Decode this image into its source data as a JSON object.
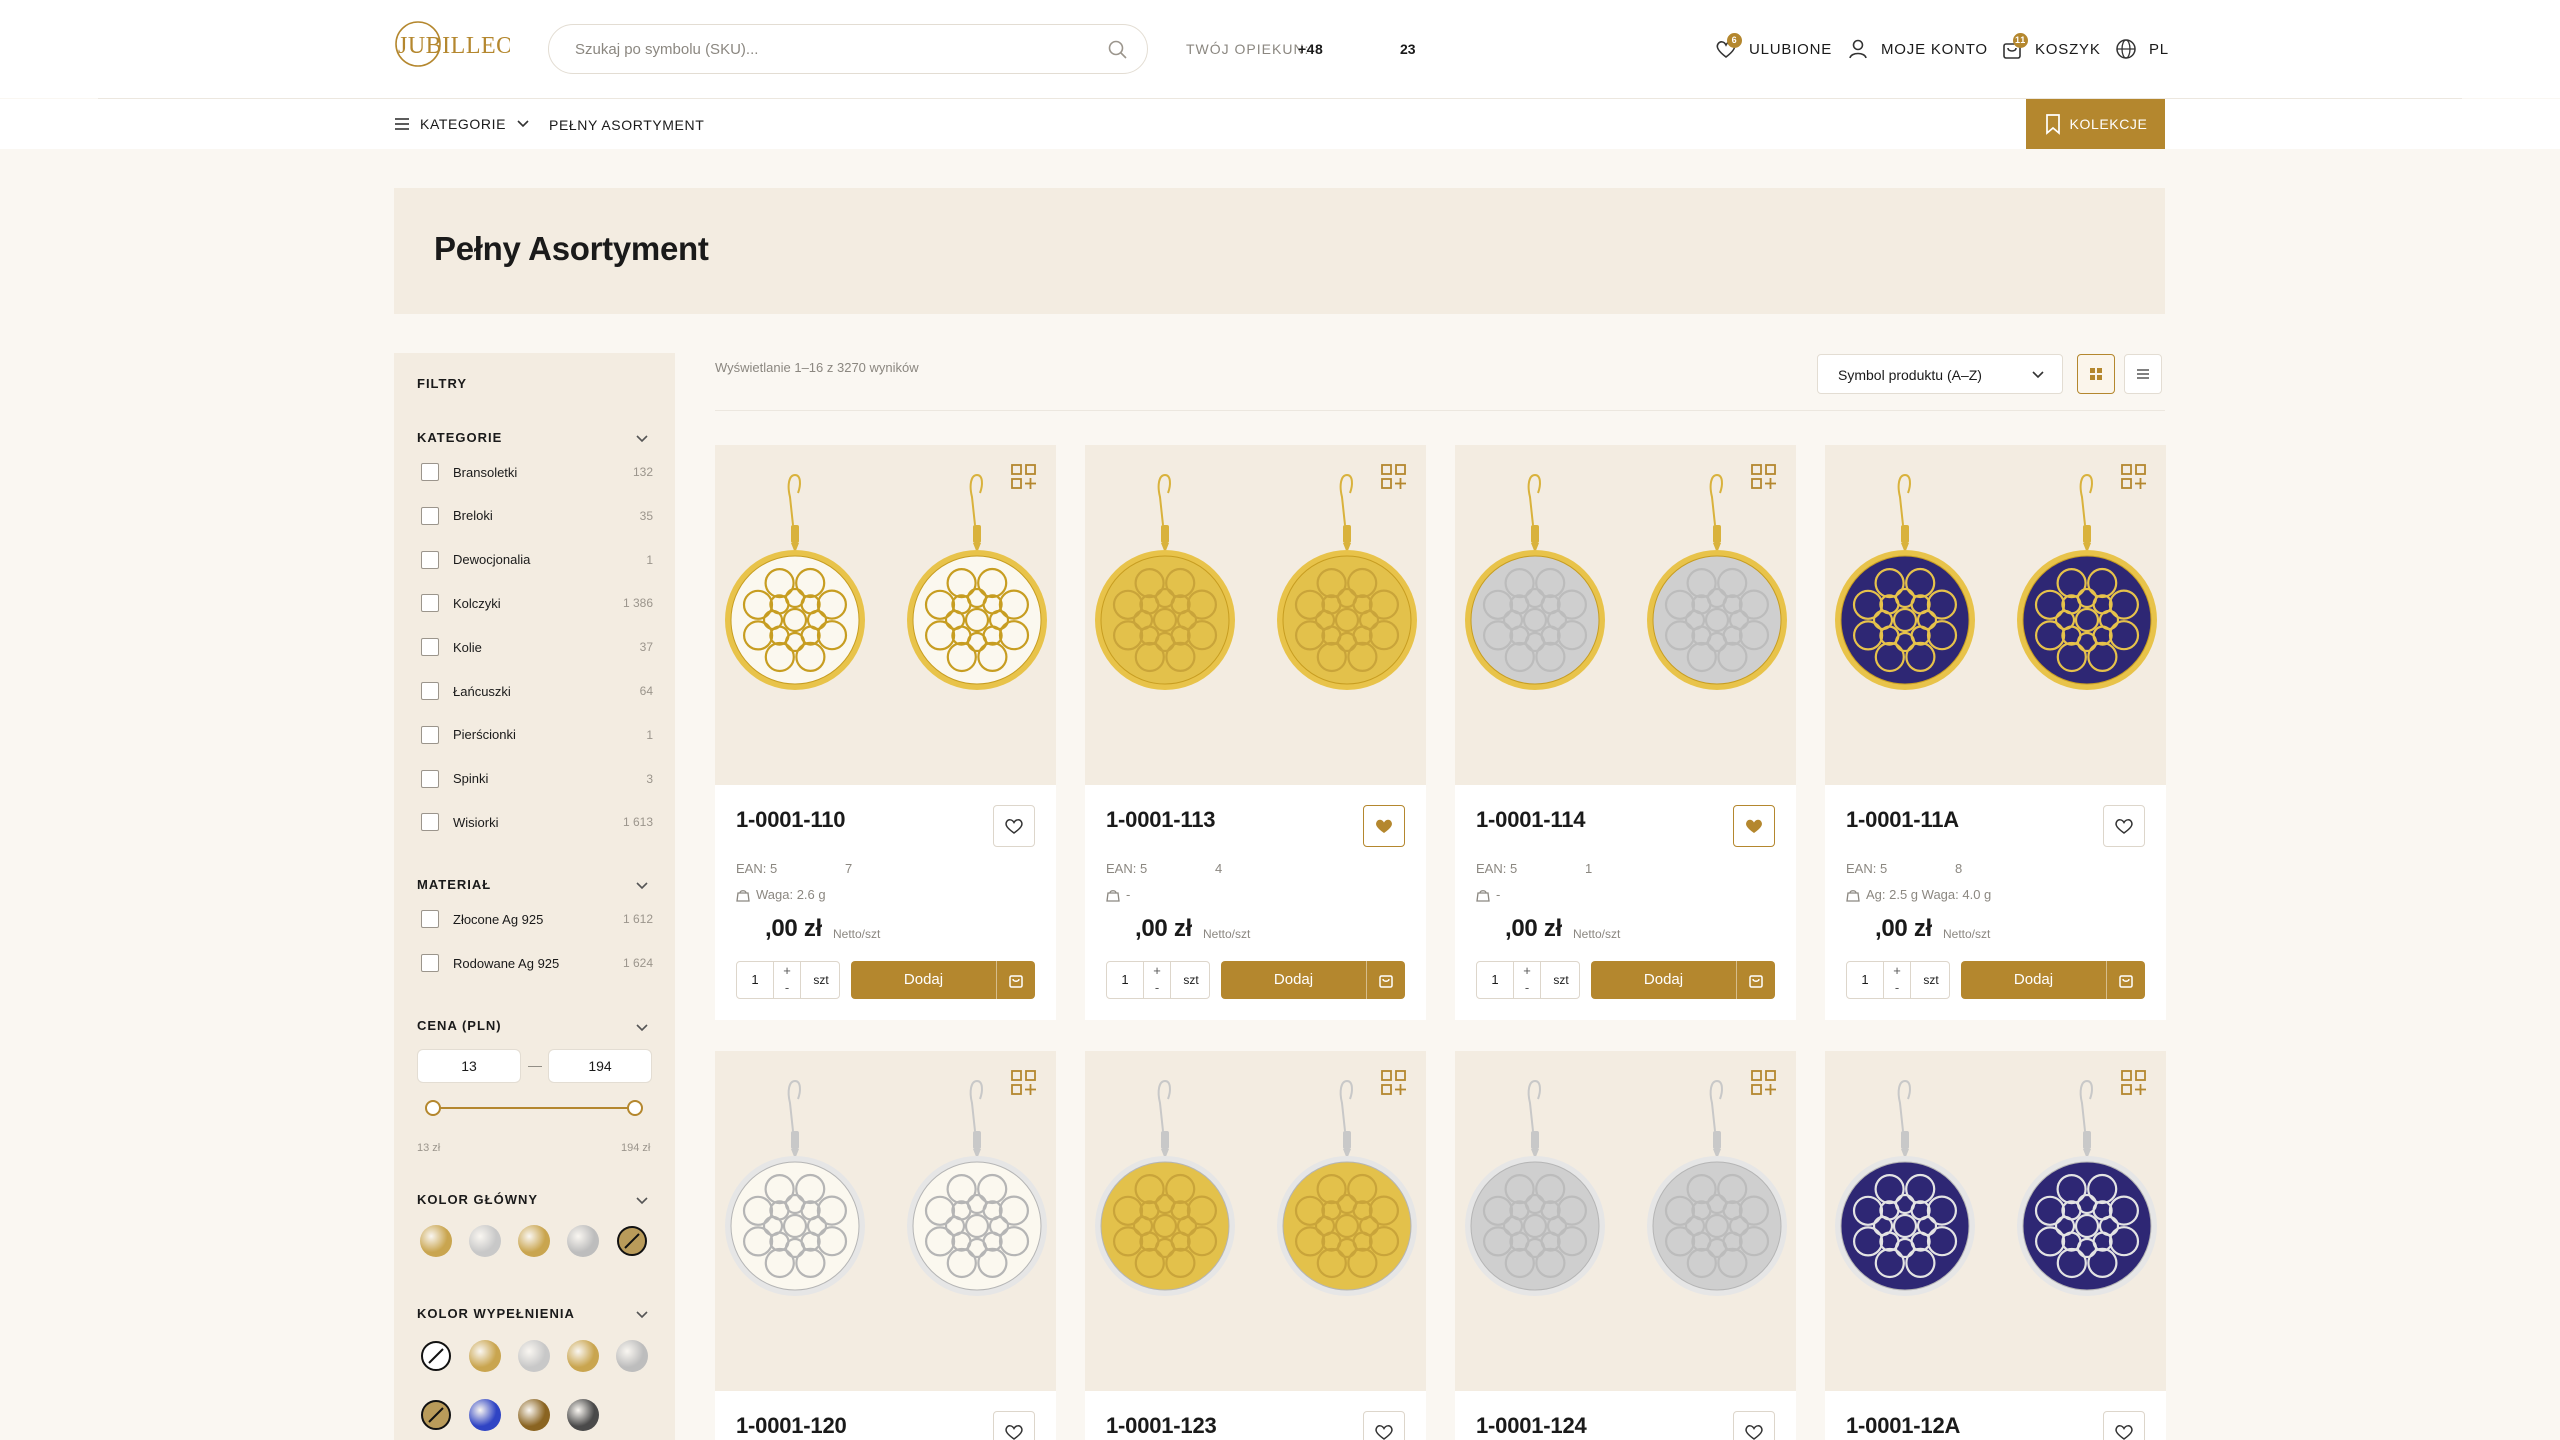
{
  "header": {
    "logo_text": "JUBILLEO",
    "search_placeholder": "Szukaj po symbolu (SKU)...",
    "opiekun_label": "TWÓJ OPIEKUN:",
    "phone_prefix": "+48",
    "phone_suffix": "23",
    "favorites_label": "ULUBIONE",
    "favorites_count": "6",
    "account_label": "MOJE KONTO",
    "cart_label": "KOSZYK",
    "cart_count": "11",
    "language_label": "PL"
  },
  "nav": {
    "categories_label": "KATEGORIE",
    "full_range_label": "PEŁNY ASORTYMENT",
    "collections_label": "KOLEKCJE"
  },
  "page_title": "Pełny Asortyment",
  "toolbar": {
    "results_text": "Wyświetlanie 1–16 z 3270 wyników",
    "sort_value": "Symbol produktu (A–Z)"
  },
  "filters": {
    "title": "FILTRY",
    "categories_title": "KATEGORIE",
    "categories": [
      {
        "label": "Bransoletki",
        "count": "132"
      },
      {
        "label": "Breloki",
        "count": "35"
      },
      {
        "label": "Dewocjonalia",
        "count": "1"
      },
      {
        "label": "Kolczyki",
        "count": "1 386"
      },
      {
        "label": "Kolie",
        "count": "37"
      },
      {
        "label": "Łańcuszki",
        "count": "64"
      },
      {
        "label": "Pierścionki",
        "count": "1"
      },
      {
        "label": "Spinki",
        "count": "3"
      },
      {
        "label": "Wisiorki",
        "count": "1 613"
      }
    ],
    "material_title": "MATERIAŁ",
    "materials": [
      {
        "label": "Złocone Ag 925",
        "count": "1 612"
      },
      {
        "label": "Rodowane Ag 925",
        "count": "1 624"
      }
    ],
    "price_title": "CENA (PLN)",
    "price_min": "13",
    "price_max": "194",
    "price_min_label": "13 zł",
    "price_max_label": "194 zł",
    "main_color_title": "KOLOR GŁÓWNY",
    "fill_color_title": "KOLOR WYPEŁNIENIA",
    "main_colors": [
      "#c9a54f",
      "#c8c8c8",
      "#c9a54f",
      "#bdbdbd",
      "none-gold"
    ],
    "fill_colors": [
      "none",
      "#c9a54f",
      "#c8c8c8",
      "#c9a54f",
      "#bdbdbd",
      "none-gold",
      "#2f44c4",
      "#8a6421",
      "#4a4a4a"
    ]
  },
  "products": [
    {
      "sku": "1-0001-110",
      "ean_a": "EAN: 5",
      "ean_b": "7",
      "meta": "Waga: 2.6 g",
      "price": ",00 zł",
      "netto": "Netto/szt",
      "qty": "1",
      "unit": "szt",
      "add_label": "Dodaj",
      "favorite": false,
      "metal": "gold",
      "fill": "white"
    },
    {
      "sku": "1-0001-113",
      "ean_a": "EAN: 5",
      "ean_b": "4",
      "meta": "-",
      "price": ",00 zł",
      "netto": "Netto/szt",
      "qty": "1",
      "unit": "szt",
      "add_label": "Dodaj",
      "favorite": true,
      "metal": "gold",
      "fill": "gold"
    },
    {
      "sku": "1-0001-114",
      "ean_a": "EAN: 5",
      "ean_b": "1",
      "meta": "-",
      "price": ",00 zł",
      "netto": "Netto/szt",
      "qty": "1",
      "unit": "szt",
      "add_label": "Dodaj",
      "favorite": true,
      "metal": "gold",
      "fill": "silver"
    },
    {
      "sku": "1-0001-11A",
      "ean_a": "EAN: 5",
      "ean_b": "8",
      "meta": "Ag: 2.5 g Waga: 4.0 g",
      "price": ",00 zł",
      "netto": "Netto/szt",
      "qty": "1",
      "unit": "szt",
      "add_label": "Dodaj",
      "favorite": false,
      "metal": "gold",
      "fill": "navy"
    },
    {
      "sku": "1-0001-120",
      "metal": "silver",
      "fill": "white"
    },
    {
      "sku": "1-0001-123",
      "metal": "silver",
      "fill": "gold"
    },
    {
      "sku": "1-0001-124",
      "metal": "silver",
      "fill": "silver"
    },
    {
      "sku": "1-0001-12A",
      "metal": "silver",
      "fill": "navy"
    }
  ],
  "colors": {
    "accent": "#b4872e",
    "panel": "#f3ece1",
    "page_bg": "#faf7f2"
  }
}
